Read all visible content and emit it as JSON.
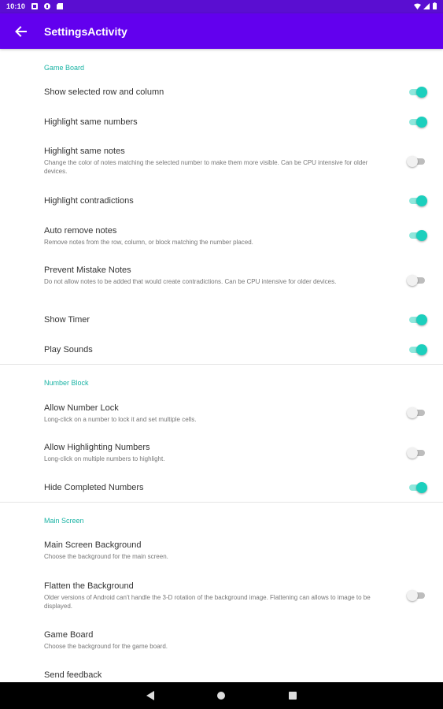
{
  "status_bar": {
    "time": "10:10"
  },
  "app_bar": {
    "title": "SettingsActivity"
  },
  "sections": {
    "game_board": {
      "title": "Game Board",
      "items": [
        {
          "title": "Show selected row and column",
          "summary": "",
          "on": true
        },
        {
          "title": "Highlight same numbers",
          "summary": "",
          "on": true
        },
        {
          "title": "Highlight same notes",
          "summary": "Change the color of notes matching the selected number to make them more visible.  Can be CPU intensive for older devices.",
          "on": false
        },
        {
          "title": "Highlight contradictions",
          "summary": "",
          "on": true
        },
        {
          "title": "Auto remove notes",
          "summary": "Remove notes from the row, column, or block matching the number placed.",
          "on": true
        },
        {
          "title": "Prevent Mistake Notes",
          "summary": "Do not allow notes to be added that would create contradictions.  Can be CPU intensive for older devices.",
          "on": false
        },
        {
          "title": "Show Timer",
          "summary": "",
          "on": true
        },
        {
          "title": "Play Sounds",
          "summary": "",
          "on": true
        }
      ]
    },
    "number_block": {
      "title": "Number Block",
      "items": [
        {
          "title": "Allow Number Lock",
          "summary": "Long-click on a number to lock it and set multiple cells.",
          "on": false
        },
        {
          "title": "Allow Highlighting Numbers",
          "summary": "Long-click on multiple numbers to highlight.",
          "on": false
        },
        {
          "title": "Hide Completed Numbers",
          "summary": "",
          "on": true
        }
      ]
    },
    "main_screen": {
      "title": "Main Screen",
      "items": [
        {
          "title": "Main Screen Background",
          "summary": "Choose the background for the main screen."
        },
        {
          "title": "Flatten the Background",
          "summary": "Older versions of Android can't handle the 3-D rotation of the background image.  Flattening can allows to image to be displayed.",
          "on": false
        },
        {
          "title": "Game Board",
          "summary": "Choose the background for the game board."
        },
        {
          "title": "Send feedback",
          "summary": ""
        }
      ]
    }
  },
  "colors": {
    "app_bar": "#6200ee",
    "status_bar": "#5a0ed1",
    "accent": "#1ccfbd",
    "section_title": "#19b3a4"
  }
}
